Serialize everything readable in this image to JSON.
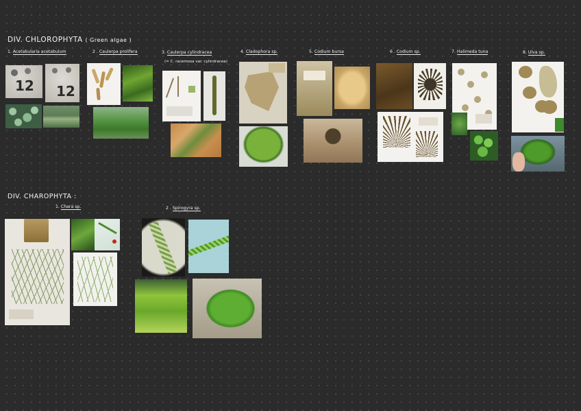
{
  "sections": {
    "chlorophyta": {
      "title": "DIV. CHLOROPHYTA",
      "subtitle": "( Green algae )",
      "labels": [
        {
          "num": "1.",
          "name": "Acetabularia acetabulum"
        },
        {
          "num": "2 .",
          "name": "Caulerpa prolifera"
        },
        {
          "num": "3.",
          "name": "Caulerpa cylindracea"
        },
        {
          "num": "4.",
          "name": "Cladophora sp."
        },
        {
          "num": "5.",
          "name": "Codium bursa"
        },
        {
          "num": "6 .",
          "name": "Codium sp."
        },
        {
          "num": "7.",
          "name": "Halimeda tuna"
        },
        {
          "num": "8.",
          "name": "Ulva sp."
        }
      ],
      "caulerpa_note": "(= C. racemosa var. cylindracea)"
    },
    "charophyta": {
      "title": "DIV. CHAROPHYTA :",
      "labels": [
        {
          "num": "1.",
          "name": "Chara sp."
        },
        {
          "num": "2 .",
          "name": "Spirogyra sp."
        }
      ]
    }
  },
  "photo_text": {
    "jar_num_1": "12",
    "jar_num_2": "12"
  },
  "colors": {
    "background": "#2b2b2b",
    "grid_dot": "#4a4a4a",
    "text": "#f4f4f4"
  }
}
